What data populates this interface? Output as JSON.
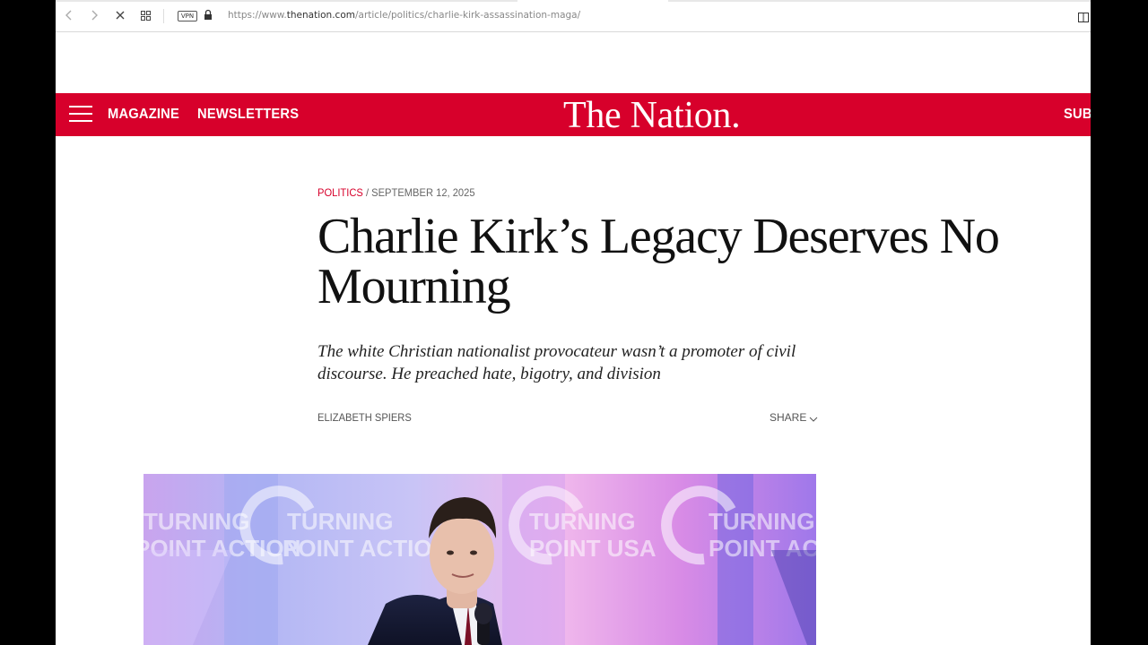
{
  "browser": {
    "url_prefix": "https://www.",
    "url_domain": "thenation.com",
    "url_path": "/article/politics/charlie-kirk-assassination-maga/",
    "vpn_label": "VPN"
  },
  "header": {
    "nav_items": [
      "MAGAZINE",
      "NEWSLETTERS"
    ],
    "logo": "The Nation.",
    "subscribe_partial": "SUB",
    "brand_color": "#d7002b"
  },
  "article": {
    "section": "POLITICS",
    "separator": " / ",
    "date": "SEPTEMBER 12, 2025",
    "headline": "Charlie Kirk’s Legacy Deserves No Mourning",
    "dek": "The white Christian nationalist provocateur wasn’t a promoter of civil discourse. He preached hate, bigotry, and division",
    "author": "ELIZABETH SPIERS",
    "share_label": "SHARE"
  },
  "hero_image": {
    "backdrop_text": [
      "TURNING",
      "POINT ACTION",
      "TURNING",
      "POINT USA",
      "TURNING",
      "POINT ACT"
    ]
  }
}
